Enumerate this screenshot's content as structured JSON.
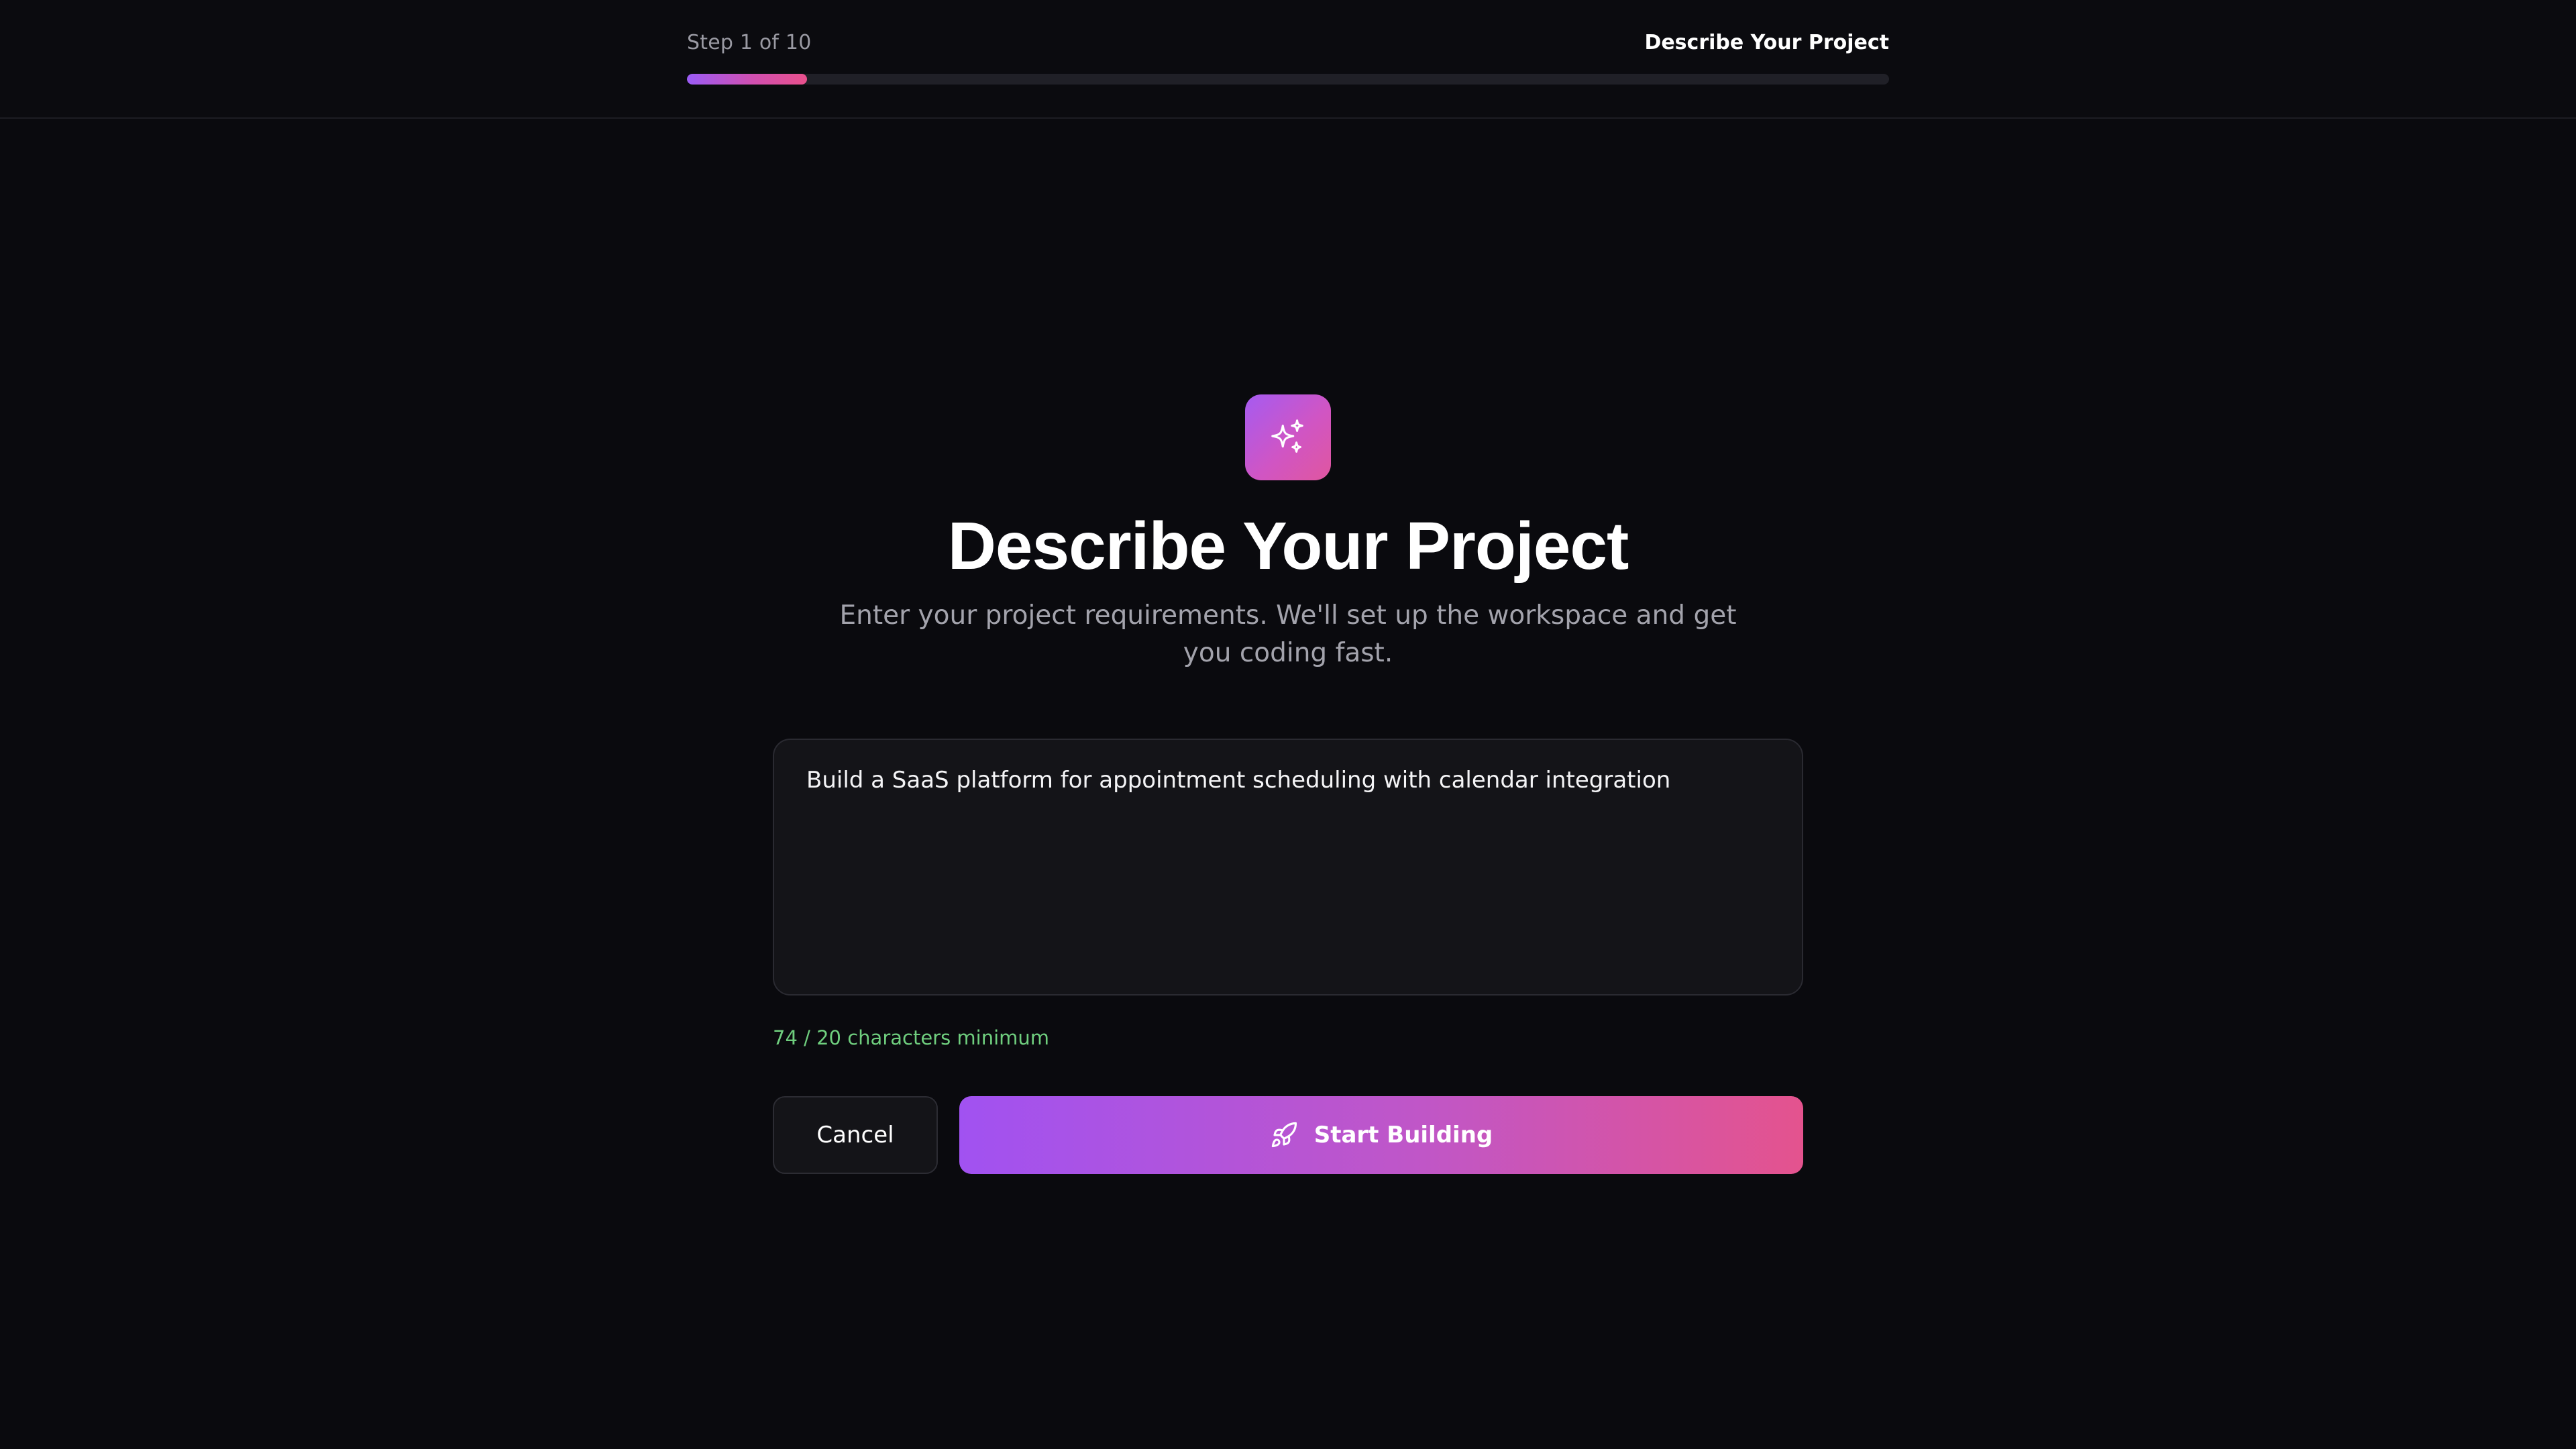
{
  "header": {
    "step_label": "Step 1 of 10",
    "step_title": "Describe Your Project",
    "progress": {
      "current": 1,
      "total": 10,
      "fraction": 0.1
    },
    "progress_colors": [
      "#9b5cf6",
      "#e9508c"
    ]
  },
  "main": {
    "icon": "sparkles-icon",
    "title": "Describe Your Project",
    "subtitle": "Enter your project requirements. We'll set up the workspace and get you coding fast.",
    "prompt": {
      "value": "Build a SaaS platform for appointment scheduling with calendar integration"
    },
    "char_count": "74 / 20 characters minimum",
    "cancel_label": "Cancel",
    "start_label": "Start Building",
    "start_icon": "rocket-icon"
  },
  "colors": {
    "background": "#0a0a0e",
    "accent_start": "#a152f1",
    "accent_end": "#e4538e",
    "success_text": "#6fce7e"
  }
}
